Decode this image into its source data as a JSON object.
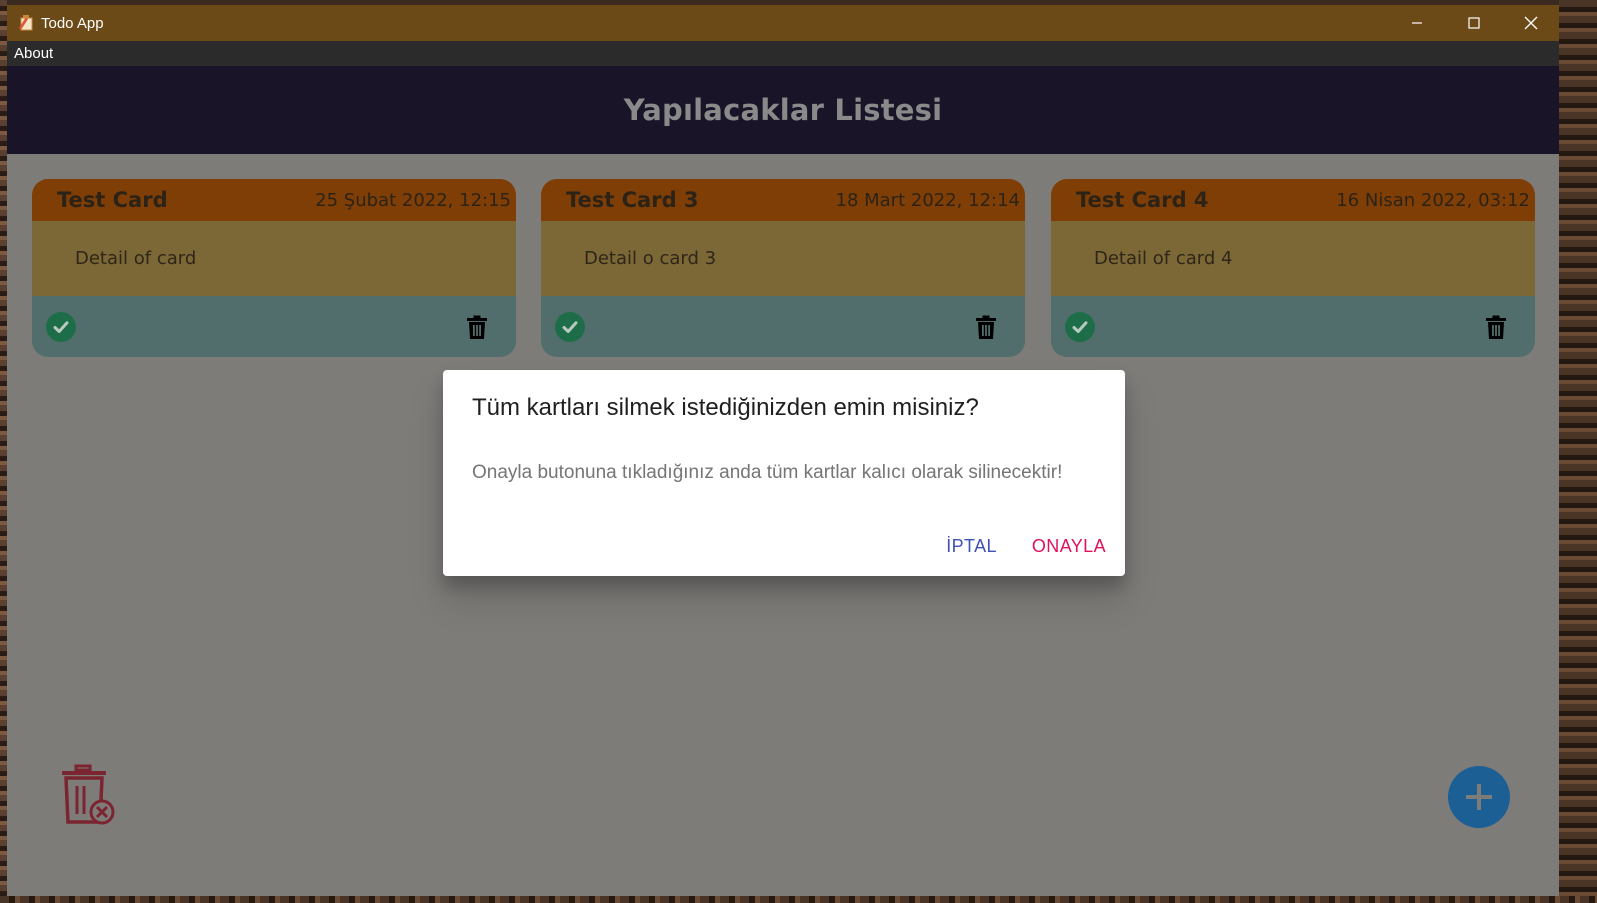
{
  "window": {
    "title": "Todo App"
  },
  "menu": {
    "items": [
      {
        "label": "About"
      }
    ]
  },
  "header": {
    "title": "Yapılacaklar Listesi"
  },
  "cards": [
    {
      "title": "Test Card",
      "date": "25 Şubat 2022, 12:15",
      "detail": "Detail of card"
    },
    {
      "title": "Test Card 3",
      "date": "18 Mart 2022, 12:14",
      "detail": "Detail o card 3"
    },
    {
      "title": "Test Card 4",
      "date": "16 Nisan 2022, 03:12",
      "detail": "Detail of card 4"
    }
  ],
  "dialog": {
    "title": "Tüm kartları silmek istediğinizden emin misiniz?",
    "message": "Onayla butonuna tıkladığınız anda tüm kartlar kalıcı olarak silinecektir!",
    "cancel_label": "İPTAL",
    "confirm_label": "ONAYLA"
  },
  "colors": {
    "titlebar": "#6b4a17",
    "header": "#191428",
    "card_head": "#7f3e06",
    "card_body": "#7c6736",
    "card_foot": "#526e6c",
    "cancel": "#3f51b5",
    "confirm": "#e0115f",
    "fab": "#1c5f94"
  },
  "icons": {
    "app": "app-icon",
    "complete": "check-circle-icon",
    "delete": "trash-icon",
    "delete_all": "trash-x-icon",
    "add": "plus-icon"
  }
}
